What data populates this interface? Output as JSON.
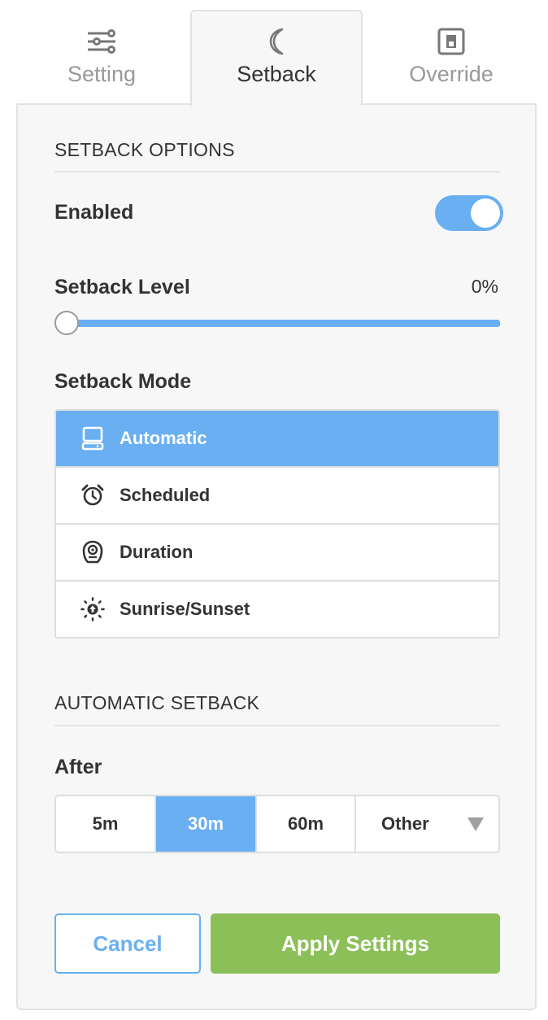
{
  "tabs": [
    {
      "label": "Setting",
      "icon": "sliders-icon",
      "active": false
    },
    {
      "label": "Setback",
      "icon": "moon-icon",
      "active": true
    },
    {
      "label": "Override",
      "icon": "switch-icon",
      "active": false
    }
  ],
  "setback_options": {
    "title": "SETBACK OPTIONS",
    "enabled_label": "Enabled",
    "enabled": true,
    "level_label": "Setback Level",
    "level_value": "0%",
    "level_percent": 0,
    "mode_label": "Setback Mode",
    "modes": [
      {
        "label": "Automatic",
        "icon": "computer-icon",
        "selected": true
      },
      {
        "label": "Scheduled",
        "icon": "alarm-clock-icon",
        "selected": false
      },
      {
        "label": "Duration",
        "icon": "sensor-icon",
        "selected": false
      },
      {
        "label": "Sunrise/Sunset",
        "icon": "sunrise-icon",
        "selected": false
      }
    ]
  },
  "automatic_setback": {
    "title": "AUTOMATIC SETBACK",
    "after_label": "After",
    "options": [
      {
        "label": "5m",
        "selected": false
      },
      {
        "label": "30m",
        "selected": true
      },
      {
        "label": "60m",
        "selected": false
      },
      {
        "label": "Other",
        "selected": false,
        "dropdown": true
      }
    ]
  },
  "actions": {
    "cancel_label": "Cancel",
    "apply_label": "Apply Settings"
  },
  "colors": {
    "accent": "#6aaff2",
    "apply": "#8bbf58",
    "panel_bg": "#f7f7f7",
    "text": "#333333",
    "muted": "#999999"
  }
}
